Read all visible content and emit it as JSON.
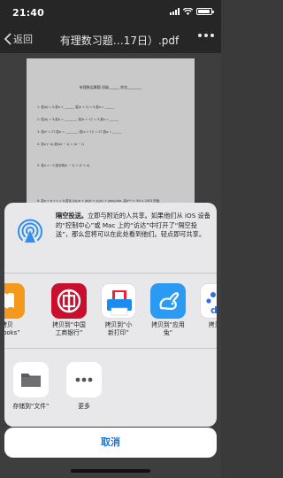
{
  "status_bar": {
    "time": "21:40",
    "battery_level": 0.9
  },
  "nav": {
    "back_label": "返回",
    "title": "有理数习题…17日）.pdf"
  },
  "document": {
    "heading": "有理数运算题  班级______  姓名________",
    "lines": [
      "1.  若|a| = 5,若a = ______,  若|a + 1| = 5,若a = ______",
      "2.  若|b| = 3,若b = ________,  若|b + 1|² = 5,若b = ______",
      "3.  若a² = 27,若a = ________;  若(a + 1)² = 27,若a = ______",
      "4.  若a·(−a),若b|a − 1| = |a − 1|",
      "5.  若a < −2,若化简|a − 1| + |2 + a|",
      "6.  若a + b + c = 0,若化 (|a|/a + |b|/b + |c|/c) + |abc|/abc ,若a¹⁰⁰ + 98 × 2003 的值."
    ]
  },
  "share_sheet": {
    "airdrop": {
      "title": "隔空投送。",
      "text": "立即与附近的人共享。如果他们从 iOS 设备的“控制中心”或 Mac 上的“访达”中打开了“隔空投送”，那么您将可以在此处看到他们。轻点即可共享。"
    },
    "apps": [
      {
        "label_line1": "拷贝",
        "label_line2": "“iBooks”",
        "icon": "ibooks-icon"
      },
      {
        "label_line1": "拷贝到“中国",
        "label_line2": "工商银行”",
        "icon": "icbc-icon"
      },
      {
        "label_line1": "拷贝到“小",
        "label_line2": "新打印”",
        "icon": "printer-icon"
      },
      {
        "label_line1": "拷贝到“应用",
        "label_line2": "兔”",
        "icon": "rabbit-icon"
      },
      {
        "label_line1": "拷贝到",
        "label_line2": "",
        "icon": "baidu-icon"
      }
    ],
    "actions": [
      {
        "label": "存储到“文件”",
        "icon": "folder-icon"
      },
      {
        "label": "更多",
        "icon": "more-icon"
      }
    ],
    "cancel_label": "取消"
  },
  "colors": {
    "accent": "#1874e8",
    "ibooks": "#f39a1e",
    "icbc": "#c8102e",
    "printer": "#1a8cf0",
    "rabbit": "#2b9af3",
    "baidu": "#2f6fe0"
  }
}
